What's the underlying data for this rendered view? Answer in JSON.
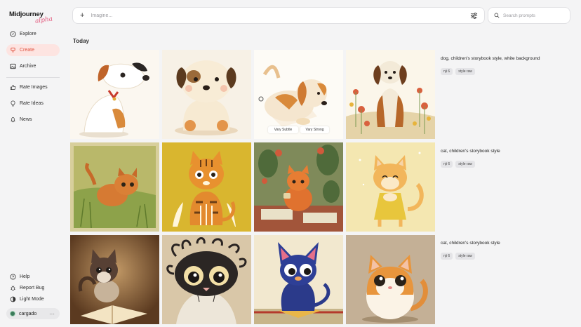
{
  "sidebar": {
    "logo": {
      "main": "Midjourney",
      "sub": "alpha"
    },
    "nav": [
      {
        "label": "Explore",
        "icon": "compass-icon"
      },
      {
        "label": "Create",
        "icon": "brush-icon",
        "active": true
      },
      {
        "label": "Archive",
        "icon": "image-icon"
      }
    ],
    "rate": [
      {
        "label": "Rate Images",
        "icon": "thumbs-up-icon"
      },
      {
        "label": "Rate Ideas",
        "icon": "lightbulb-icon"
      },
      {
        "label": "News",
        "icon": "bell-icon"
      }
    ],
    "bottom": [
      {
        "label": "Help",
        "icon": "help-icon"
      },
      {
        "label": "Report Bug",
        "icon": "bug-icon"
      },
      {
        "label": "Light Mode",
        "icon": "sun-icon"
      }
    ],
    "user": {
      "name": "cargado",
      "more": "···"
    }
  },
  "top": {
    "imagine_placeholder": "Imagine...",
    "search_placeholder": "Search prompts"
  },
  "section": {
    "title": "Today"
  },
  "rows": [
    {
      "prompt": "dog, children's storybook style, white background",
      "tags": [
        "nji 6",
        "style raw"
      ],
      "hover_buttons": [
        "Vary Subtle",
        "Vary Strong"
      ]
    },
    {
      "prompt": "cat, children's storybook style",
      "tags": [
        "nji 6",
        "style raw"
      ]
    },
    {
      "prompt": "cat, children's storybook style",
      "tags": [
        "nji 6",
        "style raw"
      ]
    }
  ],
  "colors": {
    "accent": "#e0523f",
    "active_bg": "#fde4e1",
    "alpha": "#e2557a"
  }
}
